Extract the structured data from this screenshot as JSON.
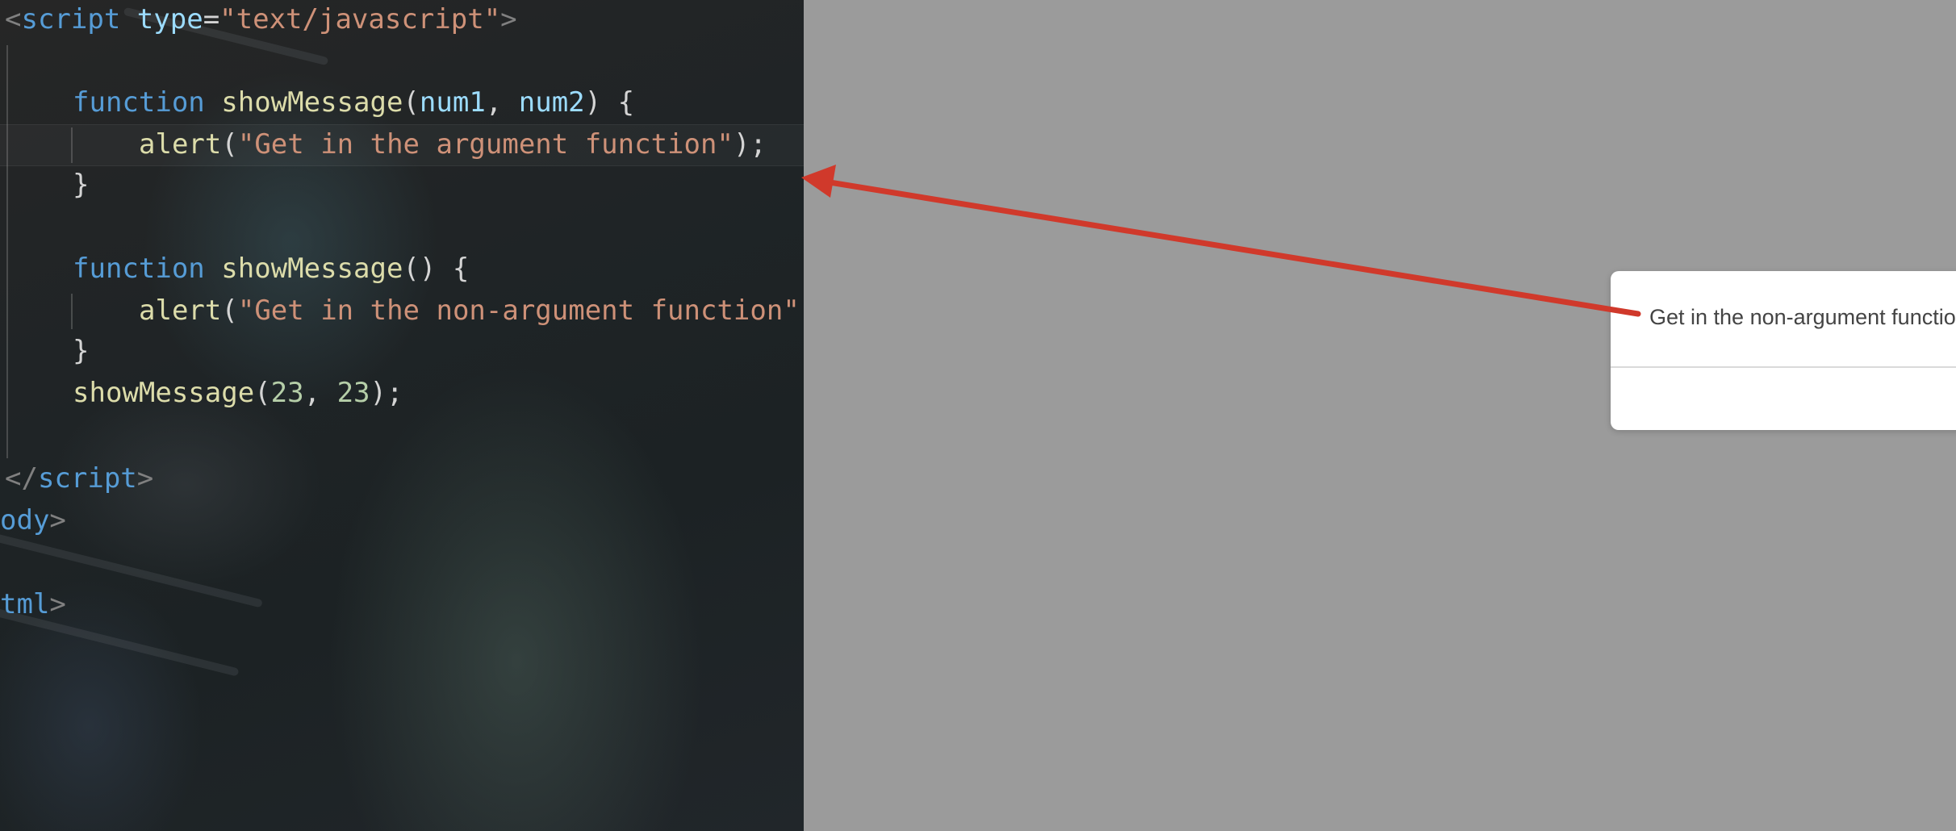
{
  "editor": {
    "lines": [
      {
        "tokens": [
          {
            "t": "<",
            "c": "c-tag"
          },
          {
            "t": "script",
            "c": "c-tagname"
          },
          {
            "t": " ",
            "c": "c-punc"
          },
          {
            "t": "type",
            "c": "c-attr"
          },
          {
            "t": "=",
            "c": "c-punc"
          },
          {
            "t": "\"text/javascript\"",
            "c": "c-str"
          },
          {
            "t": ">",
            "c": "c-tag"
          }
        ]
      },
      {
        "tokens": [
          {
            "t": "function",
            "c": "c-kw"
          },
          {
            "t": " ",
            "c": "c-punc"
          },
          {
            "t": "showMessage",
            "c": "c-fn"
          },
          {
            "t": "(",
            "c": "c-punc"
          },
          {
            "t": "num1",
            "c": "c-param"
          },
          {
            "t": ", ",
            "c": "c-punc"
          },
          {
            "t": "num2",
            "c": "c-param"
          },
          {
            "t": ") {",
            "c": "c-punc"
          }
        ]
      },
      {
        "tokens": [
          {
            "t": "alert",
            "c": "c-fn"
          },
          {
            "t": "(",
            "c": "c-punc"
          },
          {
            "t": "\"Get in the argument function\"",
            "c": "c-str"
          },
          {
            "t": ");",
            "c": "c-punc"
          }
        ]
      },
      {
        "tokens": [
          {
            "t": "}",
            "c": "c-punc"
          }
        ]
      },
      {
        "tokens": [
          {
            "t": "function",
            "c": "c-kw"
          },
          {
            "t": " ",
            "c": "c-punc"
          },
          {
            "t": "showMessage",
            "c": "c-fn"
          },
          {
            "t": "() {",
            "c": "c-punc"
          }
        ]
      },
      {
        "tokens": [
          {
            "t": "alert",
            "c": "c-fn"
          },
          {
            "t": "(",
            "c": "c-punc"
          },
          {
            "t": "\"Get in the non-argument function\"",
            "c": "c-str"
          }
        ]
      },
      {
        "tokens": [
          {
            "t": "}",
            "c": "c-punc"
          }
        ]
      },
      {
        "tokens": [
          {
            "t": "showMessage",
            "c": "c-fn"
          },
          {
            "t": "(",
            "c": "c-punc"
          },
          {
            "t": "23",
            "c": "c-num"
          },
          {
            "t": ", ",
            "c": "c-punc"
          },
          {
            "t": "23",
            "c": "c-num"
          },
          {
            "t": ");",
            "c": "c-punc"
          }
        ]
      },
      {
        "tokens": [
          {
            "t": "</",
            "c": "c-tag"
          },
          {
            "t": "script",
            "c": "c-tagname"
          },
          {
            "t": ">",
            "c": "c-tag"
          }
        ]
      },
      {
        "tokens": [
          {
            "t": "ody",
            "c": "c-tagname"
          },
          {
            "t": ">",
            "c": "c-tag"
          }
        ]
      },
      {
        "tokens": [
          {
            "t": "tml",
            "c": "c-tagname"
          },
          {
            "t": ">",
            "c": "c-tag"
          }
        ]
      }
    ]
  },
  "dialog": {
    "message": "Get in the non-argument function"
  },
  "colors": {
    "arrow": "#d0392b",
    "overlay": "#9b9b9b"
  }
}
